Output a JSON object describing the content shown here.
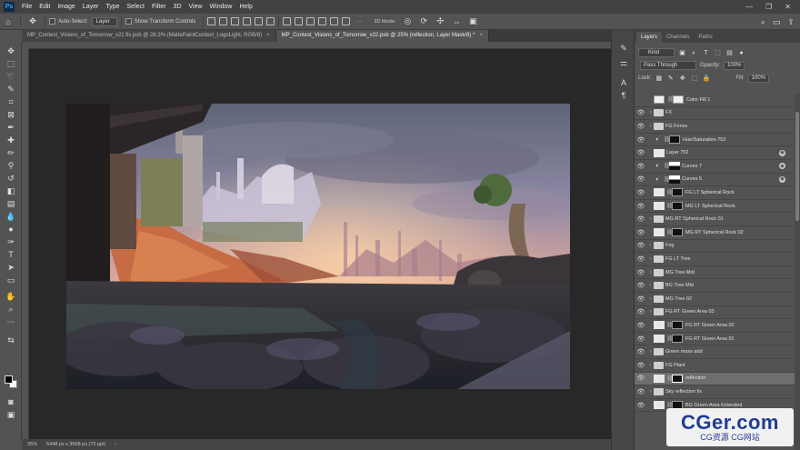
{
  "menu": [
    "File",
    "Edit",
    "Image",
    "Layer",
    "Type",
    "Select",
    "Filter",
    "3D",
    "View",
    "Window",
    "Help"
  ],
  "app_logo": "Ps",
  "options": {
    "auto_select_label": "Auto-Select:",
    "auto_select_value": "Layer",
    "show_transform_label": "Show Transform Controls",
    "mode_3d_label": "3D Mode:",
    "more_label": "···"
  },
  "tabs": [
    {
      "label": "MP_Contest_Visions_of_Tomorrow_v21 fix.psb @ 28.3% (MattePaintContest_LogoLight, RGB/8)",
      "active": false
    },
    {
      "label": "MP_Contest_Visions_of_Tomorrow_v22.psb @ 25% (reflection, Layer Mask/8) *",
      "active": true
    }
  ],
  "status": {
    "zoom": "25%",
    "doc_size": "6448 px x 3508 px (72 ppi)",
    "arrow": "›"
  },
  "panel_tabs": [
    "Layers",
    "Channels",
    "Paths"
  ],
  "layers_controls": {
    "kind": "Kind",
    "blend_mode": "Pass Through",
    "opacity_label": "Opacity:",
    "opacity_value": "100%",
    "lock_label": "Lock:",
    "fill_label": "Fill:",
    "fill_value": "100%"
  },
  "layers": [
    {
      "name": "Color Fill 1",
      "kind": "fill",
      "visible": false
    },
    {
      "name": "FX",
      "kind": "folder",
      "visible": true
    },
    {
      "name": "FG Fence",
      "kind": "folder",
      "visible": true
    },
    {
      "name": "Hue/Saturation 753",
      "kind": "adjust-mask-dark",
      "visible": true
    },
    {
      "name": "Layer 752",
      "kind": "pixel-fx",
      "visible": true
    },
    {
      "name": "Curves 7",
      "kind": "curves-fx",
      "visible": true
    },
    {
      "name": "Curves 5",
      "kind": "curves-fx",
      "visible": true
    },
    {
      "name": "FG LT Spherical Rock",
      "kind": "pixel-mask-dark",
      "visible": true
    },
    {
      "name": "MG LT Spherical Rock",
      "kind": "pixel-mask-dark",
      "visible": true
    },
    {
      "name": "MG RT Spherical Rock 01",
      "kind": "folder",
      "visible": true
    },
    {
      "name": "MG RT Spherical Rock 02",
      "kind": "pixel-mask-dark",
      "visible": true
    },
    {
      "name": "Fog",
      "kind": "folder",
      "visible": true
    },
    {
      "name": "FG LT Tree",
      "kind": "folder",
      "visible": true
    },
    {
      "name": "MG Tree Mid",
      "kind": "folder",
      "visible": true
    },
    {
      "name": "BG Tree Mid",
      "kind": "folder",
      "visible": true
    },
    {
      "name": "MG Tree 02",
      "kind": "folder",
      "visible": true
    },
    {
      "name": "FG RT Green Area 03",
      "kind": "folder",
      "visible": true
    },
    {
      "name": "FG RT Green Area 02",
      "kind": "pixel-mask-dark",
      "visible": true
    },
    {
      "name": "FG RT Green Area 01",
      "kind": "pixel-mask-dark",
      "visible": true
    },
    {
      "name": "Green moss add",
      "kind": "folder",
      "visible": true
    },
    {
      "name": "FG Plant",
      "kind": "folder",
      "visible": true
    },
    {
      "name": "reflection",
      "kind": "pixel-mask-dark",
      "visible": true,
      "selected": true
    },
    {
      "name": "Sky reflection fix",
      "kind": "folder",
      "visible": true
    },
    {
      "name": "BG Green Area Extended",
      "kind": "pixel-mask-dark",
      "visible": true
    }
  ],
  "watermark": {
    "main": "CGer.com",
    "sub": "CG资源 CG网站"
  },
  "colors": {
    "accent": "#31a8ff",
    "panel": "#535353",
    "canvas_bg": "#282828",
    "watermark": "#1f3c96"
  }
}
